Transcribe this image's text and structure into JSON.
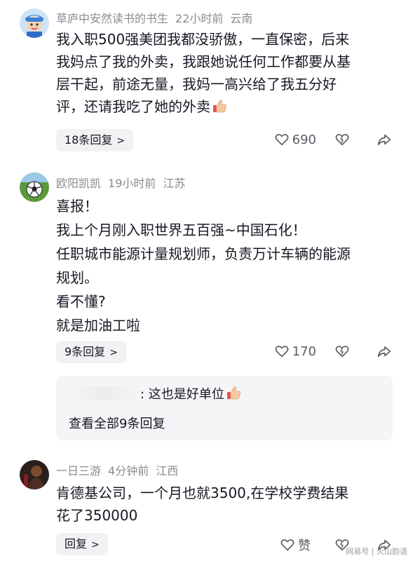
{
  "comments": [
    {
      "user": "草庐中安然读书的书生",
      "time": "22小时前",
      "location": "云南",
      "lines": [
        "我入职500强美团我都没骄傲，一直保密，后来",
        "我妈点了我的外卖，我跟她说任何工作都要从基",
        "层干起，前途无量，我妈一高兴给了我五分好",
        "评，还请我吃了她的外卖"
      ],
      "reply_btn": "18条回复",
      "likes": "690"
    },
    {
      "user": "欧阳凯凯",
      "time": "19小时前",
      "location": "江苏",
      "lines": [
        "喜报！",
        "我上个月刚入职世界五百强~中国石化！",
        "任职城市能源计量规划师，负责万计车辆的能源",
        "规划。",
        "看不懂?",
        "就是加油工啦"
      ],
      "reply_btn": "9条回复",
      "likes": "170",
      "sub_reply_text": ": 这也是好单位",
      "view_all": "查看全部9条回复"
    },
    {
      "user": "一日三游",
      "time": "4分钟前",
      "location": "江西",
      "lines": [
        "肯德基公司，一个月也就3500,在学校学费结果",
        "花了350000"
      ],
      "reply_btn": "回复",
      "likes": "赞"
    }
  ],
  "watermark": "网易号 | 火山韵语",
  "icons": [
    "heart-icon",
    "broken-heart-icon",
    "share-icon",
    "chevron-right-icon",
    "thumbs-up-emoji"
  ],
  "colors": {
    "meta": "#8a8b91",
    "pill_bg": "#f2f2f4",
    "text": "#161823"
  }
}
